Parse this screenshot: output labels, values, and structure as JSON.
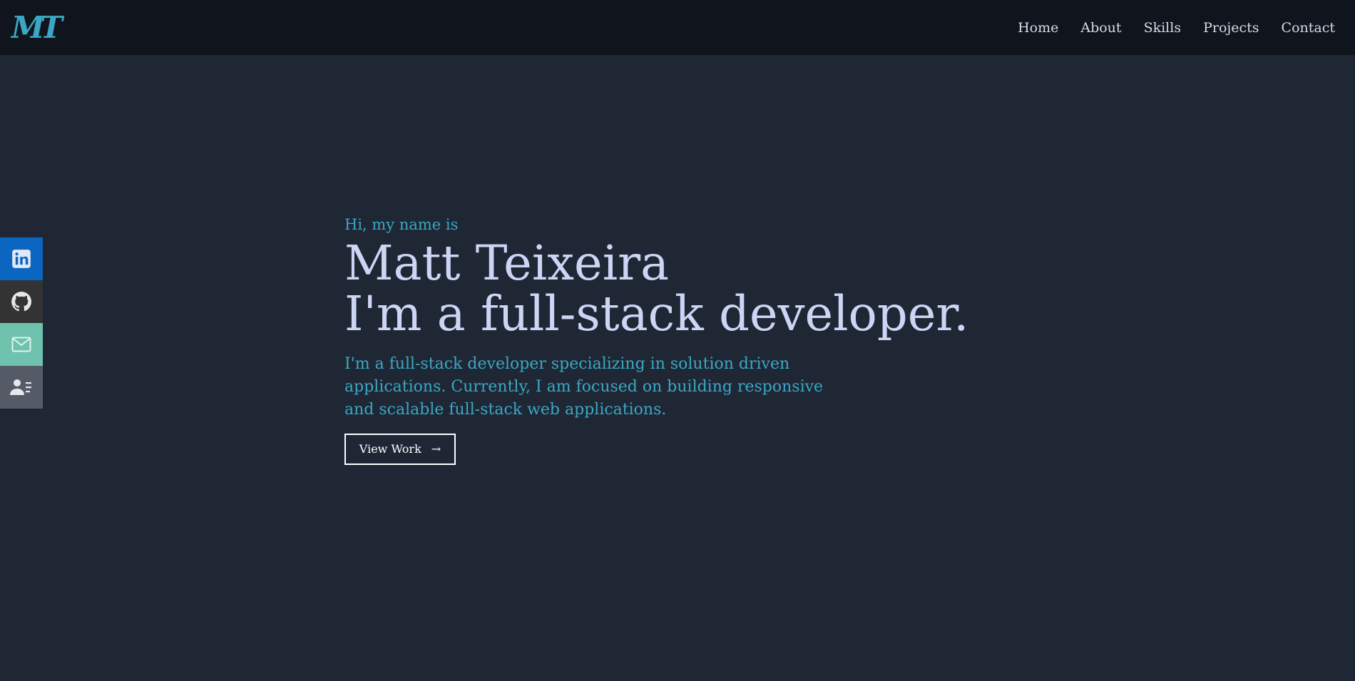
{
  "logo": {
    "text": "MT"
  },
  "nav": {
    "items": [
      {
        "label": "Home"
      },
      {
        "label": "About"
      },
      {
        "label": "Skills"
      },
      {
        "label": "Projects"
      },
      {
        "label": "Contact"
      }
    ]
  },
  "social": {
    "items": [
      {
        "icon": "linkedin-icon",
        "color": "#0b66c2"
      },
      {
        "icon": "github-icon",
        "color": "#333333"
      },
      {
        "icon": "mail-icon",
        "color": "#6fc3ae"
      },
      {
        "icon": "resume-icon",
        "color": "#545b66"
      }
    ]
  },
  "hero": {
    "greeting": "Hi, my name is",
    "name": "Matt Teixeira",
    "tagline": "I'm a full-stack developer.",
    "bio": "I'm a full-stack developer specializing in solution driven applications. Currently, I am focused on building responsive and scalable full-stack web applications.",
    "button_label": "View Work"
  },
  "colors": {
    "background": "#1f2735",
    "navbar": "#0f141d",
    "accent": "#3ba7c3",
    "heading": "#cdd5f5"
  }
}
